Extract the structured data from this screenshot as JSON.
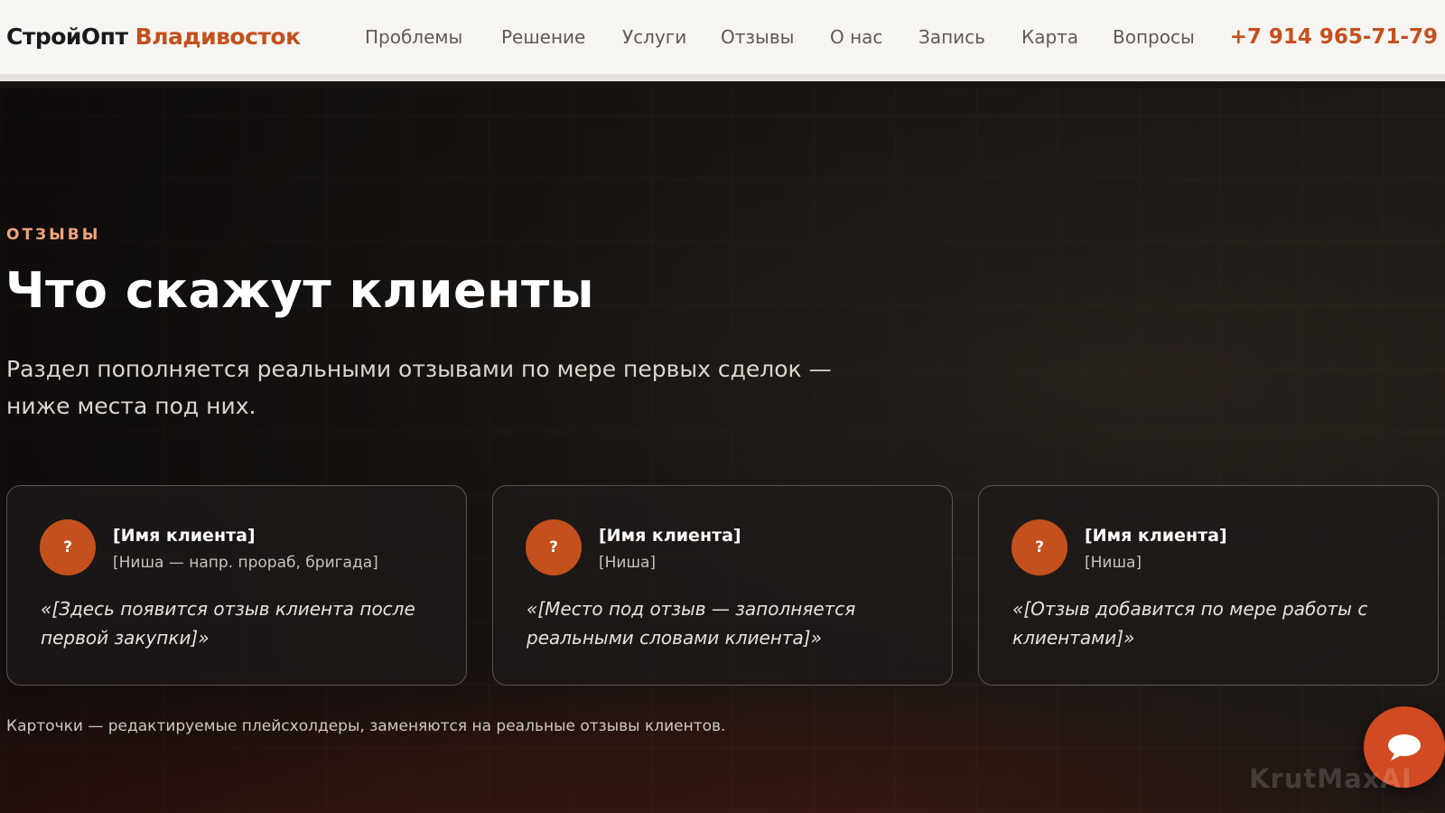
{
  "header": {
    "logo_part1": "СтройОпт",
    "logo_part2": "Владивосток",
    "nav": [
      {
        "label": "Проблемы"
      },
      {
        "label": "Решение"
      },
      {
        "label": "Услуги"
      },
      {
        "label": "Отзывы"
      },
      {
        "label": "О нас"
      },
      {
        "label": "Запись"
      },
      {
        "label": "Карта"
      },
      {
        "label": "Вопросы"
      }
    ],
    "phone": "+7 914 965-71-79"
  },
  "section": {
    "eyebrow": "ОТЗЫВЫ",
    "title": "Что скажут клиенты",
    "lead": "Раздел пополняется реальными отзывами по мере первых сделок — ниже места под них.",
    "cards": [
      {
        "avatar": "?",
        "name": "[Имя клиента]",
        "niche": "[Ниша — напр. прораб, бригада]",
        "quote": "«[Здесь появится отзыв клиента после первой закупки]»"
      },
      {
        "avatar": "?",
        "name": "[Имя клиента]",
        "niche": "[Ниша]",
        "quote": "«[Место под отзыв — заполняется реальными словами клиента]»"
      },
      {
        "avatar": "?",
        "name": "[Имя клиента]",
        "niche": "[Ниша]",
        "quote": "«[Отзыв добавится по мере работы с клиентами]»"
      }
    ],
    "note": "Карточки — редактируемые плейсхолдеры, заменяются на реальные отзывы клиентов."
  },
  "chat": {
    "icon": "chat-bubble-icon"
  },
  "watermark": "KrutMaxAI",
  "colors": {
    "accent": "#c4501d",
    "header_bg": "#f7f5f2",
    "eyebrow": "#f0a37c"
  }
}
